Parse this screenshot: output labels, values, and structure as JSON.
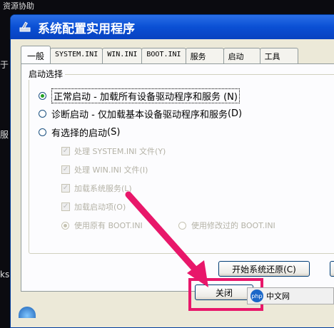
{
  "desktop": {
    "top_text": "资源协助",
    "left_char_1": "于",
    "left_char_2": "服",
    "left_text_3": "ks"
  },
  "window": {
    "title": "系统配置实用程序"
  },
  "tabs": [
    {
      "label": "一般",
      "active": true
    },
    {
      "label": "SYSTEM.INI"
    },
    {
      "label": "WIN.INI"
    },
    {
      "label": "BOOT.INI"
    },
    {
      "label": "服务"
    },
    {
      "label": "启动"
    },
    {
      "label": "工具"
    }
  ],
  "startup": {
    "group_label": "启动选择",
    "normal": "正常启动 - 加载所有设备驱动程序和服务",
    "normal_key": "(N)",
    "diagnostic": "诊断启动 - 仅加载基本设备驱动程序和服务",
    "diagnostic_key": "(D)",
    "selective": "有选择的启动",
    "selective_key": "(S)",
    "checks": [
      "处理 SYSTEM.INI 文件(Y)",
      "处理 WIN.INI 文件(I)",
      "加载系统服务(L)",
      "加载启动项(O)"
    ],
    "boot_original": "使用原有 BOOT.INI",
    "boot_modified": "使用修改过的 BOOT.INI"
  },
  "buttons": {
    "restore": "开始系统还原(C)",
    "close": "关闭"
  },
  "taskbar": {
    "ime_logo": "php",
    "ime_label": "中文网",
    "extra": ""
  },
  "colors": {
    "titlebar": "#0a4fd4",
    "highlight": "#e8176a"
  }
}
